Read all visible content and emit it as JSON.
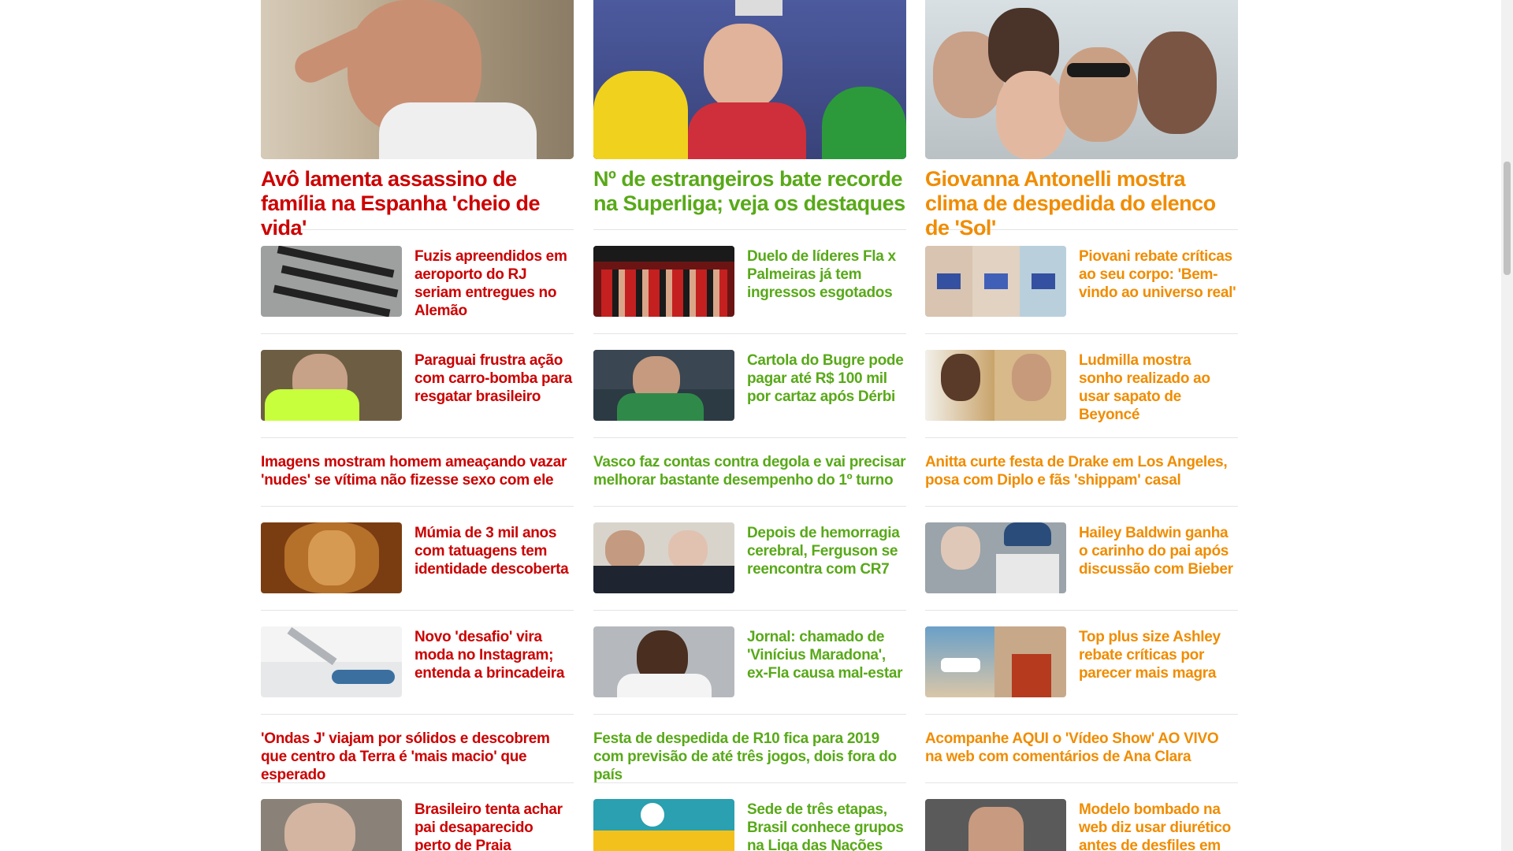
{
  "colors": {
    "news": "#cc0000",
    "sports": "#58a918",
    "entertainment": "#f08c00"
  },
  "columns": [
    {
      "section": "news",
      "hero": {
        "title": "Avô lamenta assassino de família na Espanha 'cheio de vida'",
        "image": "elderly-man-photo"
      },
      "items": [
        {
          "type": "thumb",
          "title": "Fuzis apreendidos em aeroporto do RJ seriam entregues no Alemão",
          "image": "rifles-photo"
        },
        {
          "type": "thumb",
          "title": "Paraguai frustra ação com carro-bomba para resgatar brasileiro",
          "image": "man-yellow-shirt-photo"
        },
        {
          "type": "text",
          "title": "Imagens mostram homem ameaçando vazar 'nudes' se vítima não fizesse sexo com ele"
        },
        {
          "type": "thumb",
          "title": "Múmia de 3 mil anos com tatuagens tem identidade descoberta",
          "image": "mummy-photo"
        },
        {
          "type": "thumb",
          "title": "Novo 'desafio' vira moda no Instagram; entenda a brincadeira",
          "image": "instagram-challenge-photo"
        },
        {
          "type": "text",
          "title": "'Ondas J' viajam por sólidos e descobrem que centro da Terra é 'mais macio' que esperado"
        },
        {
          "type": "thumb",
          "title": "Brasileiro tenta achar pai desaparecido perto de Praia 'Assaí'...",
          "image": "old-man-photo"
        }
      ]
    },
    {
      "section": "sports",
      "hero": {
        "title": "Nº de estrangeiros bate recorde na Superliga; veja os destaques",
        "image": "volleyball-players-selfie-photo"
      },
      "items": [
        {
          "type": "thumb",
          "title": "Duelo de líderes Fla x Palmeiras já tem ingressos esgotados",
          "image": "flamengo-fans-photo"
        },
        {
          "type": "thumb",
          "title": "Cartola do Bugre pode pagar até R$ 100 mil por cartaz após Dérbi",
          "image": "guarani-player-interview-photo"
        },
        {
          "type": "text",
          "title": "Vasco faz contas contra degola e vai precisar melhorar bastante desempenho do 1º turno"
        },
        {
          "type": "thumb",
          "title": "Depois de hemorragia cerebral, Ferguson se reencontra com CR7",
          "image": "ferguson-cr7-photo"
        },
        {
          "type": "thumb",
          "title": "Jornal: chamado de 'Vinícius Maradona', ex-Fla causa mal-estar",
          "image": "vinicius-photo"
        },
        {
          "type": "text",
          "title": "Festa de despedida de R10 fica para 2019 com previsão de até três jogos, dois fora do país"
        },
        {
          "type": "thumb",
          "title": "Sede de três etapas, Brasil conhece grupos na Liga das Nações",
          "image": "volleyball-match-photo"
        }
      ]
    },
    {
      "section": "entertainment",
      "hero": {
        "title": "Giovanna Antonelli mostra clima de despedida do elenco de 'Sol'",
        "image": "cast-group-selfie-photo"
      },
      "items": [
        {
          "type": "thumb",
          "title": "Piovani rebate críticas ao seu corpo: 'Bem-vindo ao universo real'",
          "image": "bikini-photos"
        },
        {
          "type": "thumb",
          "title": "Ludmilla mostra sonho realizado ao usar sapato de Beyoncé",
          "image": "ludmilla-beyonce-photo"
        },
        {
          "type": "text",
          "title": "Anitta curte festa de Drake em Los Angeles, posa com Diplo e fãs 'shippam' casal"
        },
        {
          "type": "thumb",
          "title": "Hailey Baldwin ganha o carinho do pai após discussão com Bieber",
          "image": "hailey-bieber-photo"
        },
        {
          "type": "thumb",
          "title": "Top plus size Ashley rebate críticas por parecer mais magra",
          "image": "ashley-photo"
        },
        {
          "type": "text",
          "title": "Acompanhe AQUI o 'Vídeo Show' AO VIVO na web com comentários de Ana Clara"
        },
        {
          "type": "thumb",
          "title": "Modelo bombado na web diz usar diurético antes de desfiles em SP",
          "image": "model-photo"
        }
      ]
    }
  ]
}
